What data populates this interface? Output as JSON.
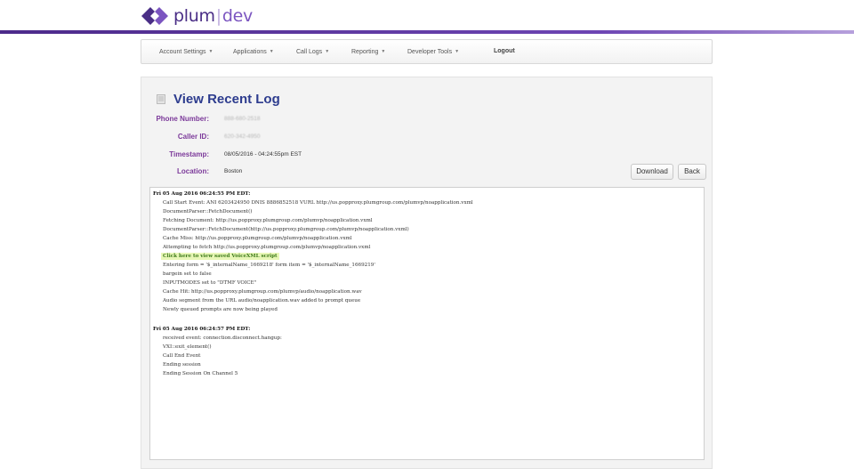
{
  "brand": {
    "name_primary": "plum",
    "separator": "|",
    "name_secondary": "dev",
    "colors": {
      "primary": "#4a2e86",
      "accent": "#7b55c0"
    }
  },
  "nav": {
    "items": [
      {
        "label": "Account Settings",
        "has_caret": true
      },
      {
        "label": "Applications",
        "has_caret": true
      },
      {
        "label": "Call Logs",
        "has_caret": true
      },
      {
        "label": "Reporting",
        "has_caret": true
      },
      {
        "label": "Developer Tools",
        "has_caret": true
      },
      {
        "label": "Logout",
        "has_caret": false
      }
    ]
  },
  "page": {
    "icon": "document-icon",
    "title": "View Recent Log"
  },
  "meta": {
    "phone_number": {
      "label": "Phone Number:",
      "value": "888-680-2518"
    },
    "caller_id": {
      "label": "Caller ID:",
      "value": "620-342-4950"
    },
    "timestamp": {
      "label": "Timestamp:",
      "value": "08/05/2016 - 04:24:55pm EST"
    },
    "location": {
      "label": "Location:",
      "value": "Boston"
    }
  },
  "buttons": {
    "download": "Download",
    "back": "Back"
  },
  "log": {
    "lines": [
      {
        "type": "header",
        "text": "Fri 05 Aug 2016 06:24:55 PM EDT:"
      },
      {
        "type": "entry",
        "text": "Call Start Event: ANI 6203424950 DNIS 8886852518 VURL http://us.popproxy.plumgroup.com/plumvp/noapplication.vxml"
      },
      {
        "type": "entry",
        "text": "DocumentParser::FetchDocument()"
      },
      {
        "type": "entry",
        "text": "Fetching Document: http://us.popproxy.plumgroup.com/plumvp/noapplication.vxml"
      },
      {
        "type": "entry",
        "text": "DocumentParser::FetchDocument(http://us.popproxy.plumgroup.com/plumvp/noapplication.vxml)"
      },
      {
        "type": "entry",
        "text": "Cache Miss: http://us.popproxy.plumgroup.com/plumvp/noapplication.vxml"
      },
      {
        "type": "entry",
        "text": "Attempting to fetch http://us.popproxy.plumgroup.com/plumvp/noapplication.vxml"
      },
      {
        "type": "link",
        "text": "Click here to view saved VoiceXML script"
      },
      {
        "type": "entry",
        "text": "Entering form = '$_internalName_1669218' form item = '$_internalName_1669219'"
      },
      {
        "type": "entry",
        "text": "bargein set to false"
      },
      {
        "type": "entry",
        "text": "INPUTMODES set to \"DTMF VOICE\""
      },
      {
        "type": "entry",
        "text": "Cache Hit: http://us.popproxy.plumgroup.com/plumvp/audio/noapplication.wav"
      },
      {
        "type": "entry",
        "text": "Audio segment from the URL audio/noapplication.wav added to prompt queue"
      },
      {
        "type": "entry",
        "text": "Newly queued prompts are now being played"
      },
      {
        "type": "header",
        "text": "Fri 05 Aug 2016 06:24:57 PM EDT:"
      },
      {
        "type": "entry",
        "text": "received event: connection.disconnect.hangup:"
      },
      {
        "type": "entry",
        "text": "VXI::exit_element()"
      },
      {
        "type": "entry",
        "text": "Call End Event"
      },
      {
        "type": "entry",
        "text": "Ending session"
      },
      {
        "type": "entry",
        "text": "Ending Session On Channel 5"
      }
    ]
  }
}
